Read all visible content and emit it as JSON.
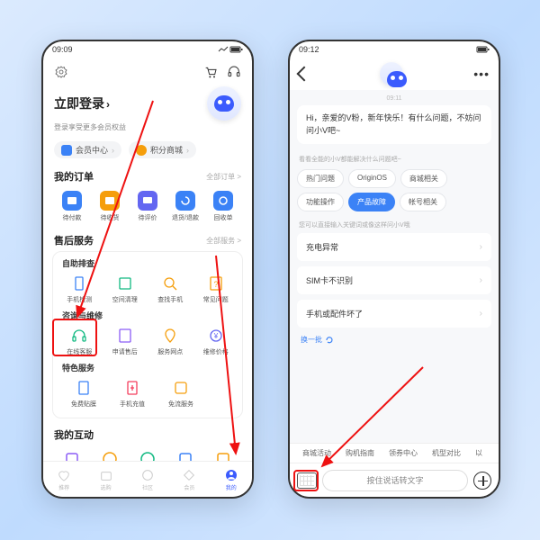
{
  "left": {
    "status_time": "09:09",
    "login_title": "立即登录",
    "login_sub": "登录享受更多会员权益",
    "pills": [
      {
        "label": "会员中心",
        "color": "#3b82f6"
      },
      {
        "label": "积分商城",
        "color": "#f59e0b"
      }
    ],
    "orders": {
      "title": "我的订单",
      "more": "全部订单 >",
      "items": [
        {
          "label": "待付款",
          "color": "#3b82f6"
        },
        {
          "label": "待收货",
          "color": "#f59e0b"
        },
        {
          "label": "待评价",
          "color": "#6366f1"
        },
        {
          "label": "退货/退款",
          "color": "#3b82f6"
        },
        {
          "label": "回收单",
          "color": "#3b82f6"
        }
      ]
    },
    "after": {
      "title": "售后服务",
      "more": "全部服务 >",
      "groups": [
        {
          "title": "自助排查",
          "items": [
            {
              "label": "手机检测",
              "color": "#3b82f6"
            },
            {
              "label": "空间清理",
              "color": "#10b981"
            },
            {
              "label": "查找手机",
              "color": "#f59e0b"
            },
            {
              "label": "常见问题",
              "color": "#f59e0b"
            }
          ]
        },
        {
          "title": "咨询与维修",
          "items": [
            {
              "label": "在线客服",
              "color": "#10b981"
            },
            {
              "label": "申请售后",
              "color": "#8b5cf6"
            },
            {
              "label": "服务网点",
              "color": "#f59e0b"
            },
            {
              "label": "维修价格",
              "color": "#6366f1"
            }
          ]
        },
        {
          "title": "特色服务",
          "items": [
            {
              "label": "免费贴膜",
              "color": "#3b82f6"
            },
            {
              "label": "手机充值",
              "color": "#f43f5e"
            },
            {
              "label": "免流服务",
              "color": "#f59e0b"
            }
          ]
        }
      ]
    },
    "interact": {
      "title": "我的互动",
      "colors": [
        "#8b5cf6",
        "#f59e0b",
        "#10b981",
        "#3b82f6",
        "#f59e0b"
      ]
    },
    "tabs": [
      "推荐",
      "选购",
      "社区",
      "会员",
      "我的"
    ]
  },
  "right": {
    "status_time": "09:12",
    "chat_time": "09:11",
    "greeting": "Hi，亲爱的V粉，新年快乐！有什么问题，不妨问问小V吧~",
    "chip_hint": "看看全能的小V都能解决什么问题吧~",
    "chips": [
      "热门问题",
      "OriginOS",
      "商城相关",
      "功能操作",
      "产品故障",
      "帐号相关"
    ],
    "chip_active": 4,
    "q_hint": "您可以直接输入关键词或像这样问小V哦",
    "questions": [
      "充电异常",
      "SIM卡不识别",
      "手机或配件坏了"
    ],
    "refresh": "换一批",
    "tags": [
      "商城活动",
      "购机指南",
      "领券中心",
      "机型对比",
      "以"
    ],
    "voice_placeholder": "按住说话转文字"
  }
}
